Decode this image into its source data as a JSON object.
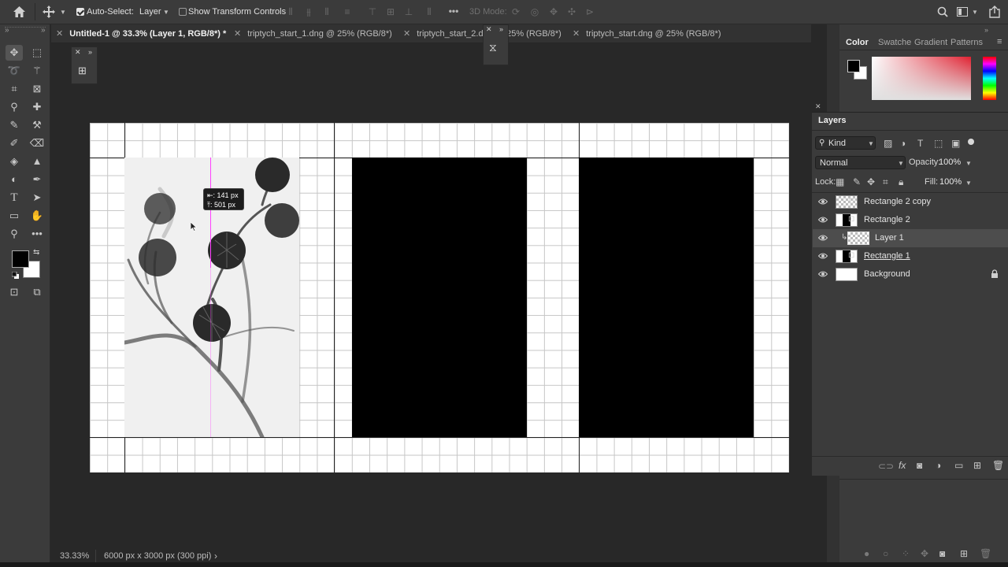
{
  "options_bar": {
    "auto_select_label": "Auto-Select:",
    "auto_select_value": "Layer",
    "transform_label": "Show Transform Controls",
    "mode_3d_label": "3D Mode:"
  },
  "tabs": [
    {
      "label": "Untitled-1 @ 33.3% (Layer 1, RGB/8*) *",
      "active": true
    },
    {
      "label": "triptych_start_1.dng @ 25% (RGB/8*)",
      "active": false
    },
    {
      "label": "triptych_start_2.dng @ 25% (RGB/8*)",
      "active": false
    },
    {
      "label": "triptych_start.dng @ 25% (RGB/8*)",
      "active": false
    }
  ],
  "measure": {
    "line1": "⇤: 141 px",
    "line2": "⤒: 501 px"
  },
  "status": {
    "zoom": "33.33%",
    "doc_info": "6000 px x 3000 px (300 ppi)",
    "arrow": "›"
  },
  "color_panel": {
    "tabs": [
      "Color",
      "Swatche",
      "Gradient",
      "Patterns"
    ],
    "active_tab": "Color"
  },
  "layers_panel": {
    "title": "Layers",
    "filter_kind": "Kind",
    "blend_mode": "Normal",
    "opacity_label": "Opacity:",
    "opacity_value": "100%",
    "lock_label": "Lock:",
    "fill_label": "Fill:",
    "fill_value": "100%",
    "layers": [
      {
        "name": "Rectangle 2 copy",
        "selected": false,
        "underline": false
      },
      {
        "name": "Rectangle 2",
        "selected": false,
        "underline": false
      },
      {
        "name": "Layer 1",
        "selected": true,
        "underline": false
      },
      {
        "name": "Rectangle 1",
        "selected": false,
        "underline": true
      },
      {
        "name": "Background",
        "selected": false,
        "underline": false
      }
    ]
  },
  "colors": {
    "accent": "#4a8fe7",
    "guide": "#ff40ff",
    "panel": "#3b3b3b",
    "workspace": "#282828"
  }
}
